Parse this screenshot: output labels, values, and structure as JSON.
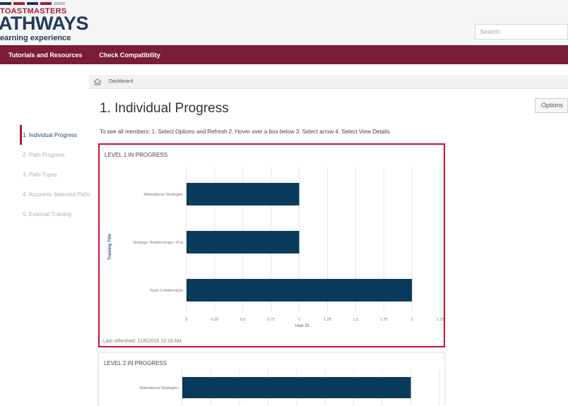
{
  "header": {
    "logo_small": "TOASTMASTERS",
    "logo_big": "ATHWAYS",
    "logo_tag": "earning experience",
    "stripe_colors": [
      "#1f3a5b",
      "#a51e36",
      "#1f3a5b",
      "#a51e36",
      "#b9c3ce"
    ],
    "search_placeholder": "Search"
  },
  "nav": {
    "items": [
      "Tutorials and Resources",
      "Check Compatibility"
    ]
  },
  "breadcrumb": {
    "home_icon": "home-icon",
    "current": "Dashboard"
  },
  "page": {
    "title": "1. Individual Progress",
    "options_label": "Options",
    "instructions": "To see all members: 1. Select Options and Refresh 2. Hover over a box below 3. Select arrow 4. Select View Details"
  },
  "sidebar": {
    "items": [
      {
        "label": "1. Individual Progress",
        "active": true
      },
      {
        "label": "2. Path Progress",
        "active": false
      },
      {
        "label": "3. Path Types",
        "active": false
      },
      {
        "label": "4. Accounts Selected Paths",
        "active": false
      },
      {
        "label": "5. External Training",
        "active": false
      }
    ]
  },
  "colors": {
    "brand_maroon": "#7b1d36",
    "brand_navy": "#1f3a5b",
    "bar": "#0b3b5c",
    "highlight": "#c8102e"
  },
  "cards": [
    {
      "title": "LEVEL 1 IN PROGRESS",
      "footer": "Last refreshed: 11/6/2016 10:18 AM",
      "chart_data": {
        "type": "bar",
        "orientation": "horizontal",
        "categories": [
          "Motivational Strategies",
          "Strategic Relationships / Proj",
          "Team Collaboration"
        ],
        "values": [
          1,
          1,
          2
        ],
        "xlabel": "User ID",
        "ylabel": "Training Title",
        "xlim": [
          0,
          2.25
        ],
        "xticks": [
          "0",
          "0.25",
          "0.5",
          "0.75",
          "1",
          "1.25",
          "1.5",
          "1.75",
          "2",
          "2.25"
        ],
        "grid": true
      }
    },
    {
      "title": "LEVEL 2 IN PROGRESS",
      "chart_data": {
        "type": "bar",
        "orientation": "horizontal",
        "categories": [
          "Motivational Strategies"
        ],
        "values": [
          2
        ],
        "xlim": [
          0,
          2.25
        ],
        "grid": true
      }
    }
  ]
}
